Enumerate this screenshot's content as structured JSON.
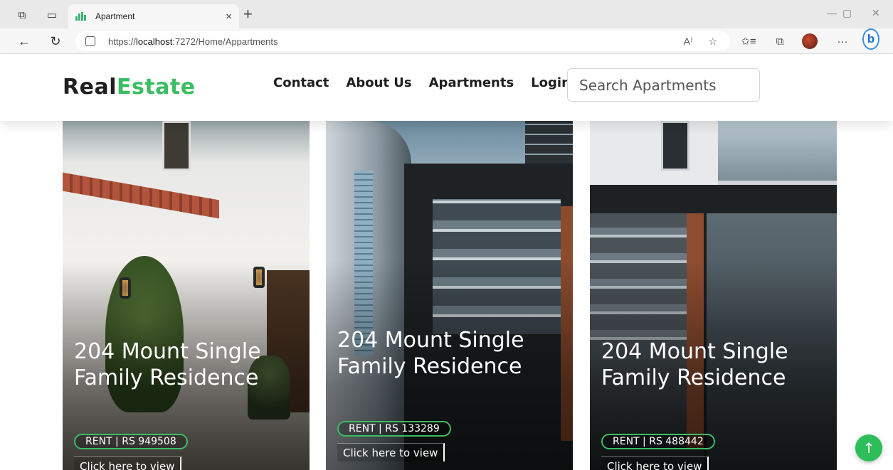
{
  "browser": {
    "tab_title": "Apartment",
    "tab_close": "×",
    "new_tab": "+",
    "url_prefix": "https://",
    "url_host": "localhost",
    "url_rest": ":7272/Home/Appartments",
    "read_aloud": "A⁾",
    "more": "···"
  },
  "header": {
    "logo_primary": "Real",
    "logo_accent": "Estate",
    "nav": [
      "Contact",
      "About Us",
      "Apartments",
      "Login"
    ],
    "search_placeholder": "Search Apartments"
  },
  "cards": [
    {
      "title": "204 Mount Single Family Residence",
      "price": "RENT | RS 949508",
      "link": "Click here to view"
    },
    {
      "title": "204 Mount Single Family Residence",
      "price": "RENT | RS 133289",
      "link": "Click here to view"
    },
    {
      "title": "204 Mount Single Family Residence",
      "price": "RENT | RS 488442",
      "link": "Click here to view"
    }
  ],
  "colors": {
    "accent_green": "#3bbd63",
    "scroll_top_button": "#2ebd59"
  },
  "icons": {
    "scroll_top": "arrow-up-icon"
  }
}
